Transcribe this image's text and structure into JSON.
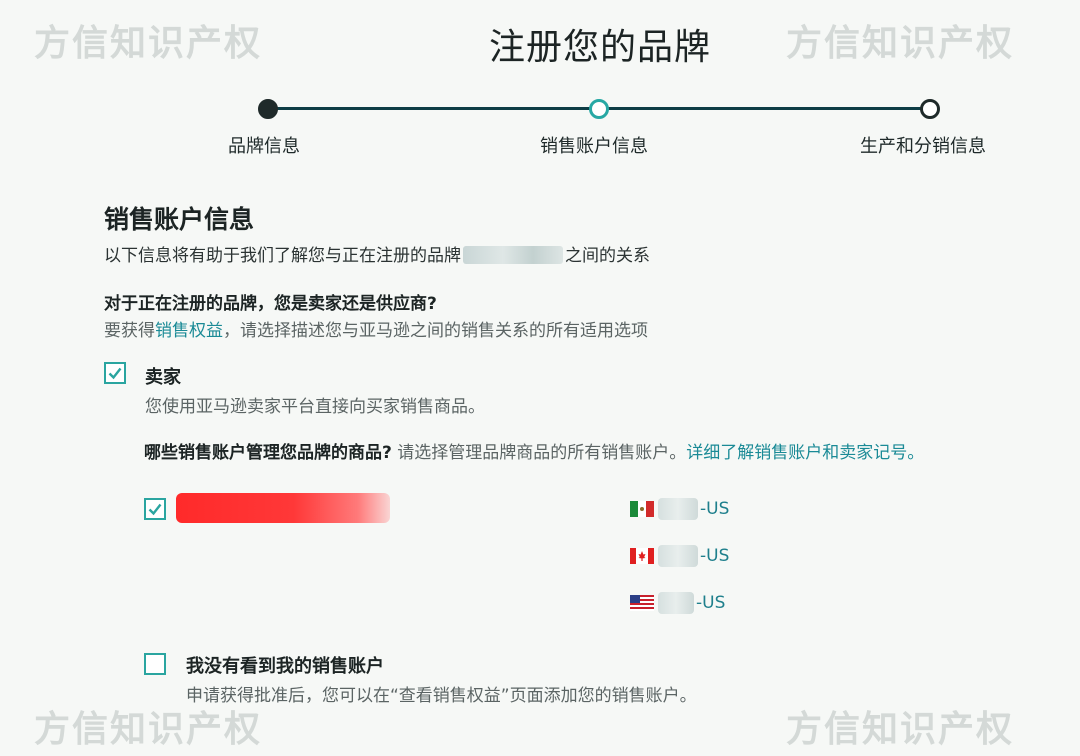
{
  "watermark": "方信知识产权",
  "page_title": "注册您的品牌",
  "steps": [
    {
      "label": "品牌信息",
      "state": "done"
    },
    {
      "label": "销售账户信息",
      "state": "active"
    },
    {
      "label": "生产和分销信息",
      "state": "pending"
    }
  ],
  "section": {
    "title": "销售账户信息",
    "desc_before": "以下信息将有助于我们了解您与正在注册的品牌",
    "desc_after": "之间的关系"
  },
  "question": {
    "title": "对于正在注册的品牌，您是卖家还是供应商?",
    "hint_before": "要获得",
    "hint_link": "销售权益",
    "hint_after": "，请选择描述您与亚马逊之间的销售关系的所有适用选项"
  },
  "seller_option": {
    "label": "卖家",
    "sub": "您使用亚马逊卖家平台直接向买家销售商品。",
    "checked": true
  },
  "accounts_question": {
    "title": "哪些销售账户管理您品牌的商品?",
    "hint": "请选择管理品牌商品的所有销售账户。",
    "link": "详细了解销售账户和卖家记号。"
  },
  "account_group": {
    "checked": true,
    "accounts": [
      {
        "flag": "mexico-flag-icon",
        "suffix": "-US"
      },
      {
        "flag": "canada-flag-icon",
        "suffix": "-US"
      },
      {
        "flag": "usa-flag-icon",
        "suffix": "-US"
      }
    ]
  },
  "no_account_option": {
    "label": "我没有看到我的销售账户",
    "sub": "申请获得批准后，您可以在“查看销售权益”页面添加您的销售账户。",
    "checked": false
  },
  "colors": {
    "accent": "#27a8a4",
    "link": "#1a8a96",
    "dark": "#0e3d45",
    "redaction": "#ff2a2a"
  }
}
